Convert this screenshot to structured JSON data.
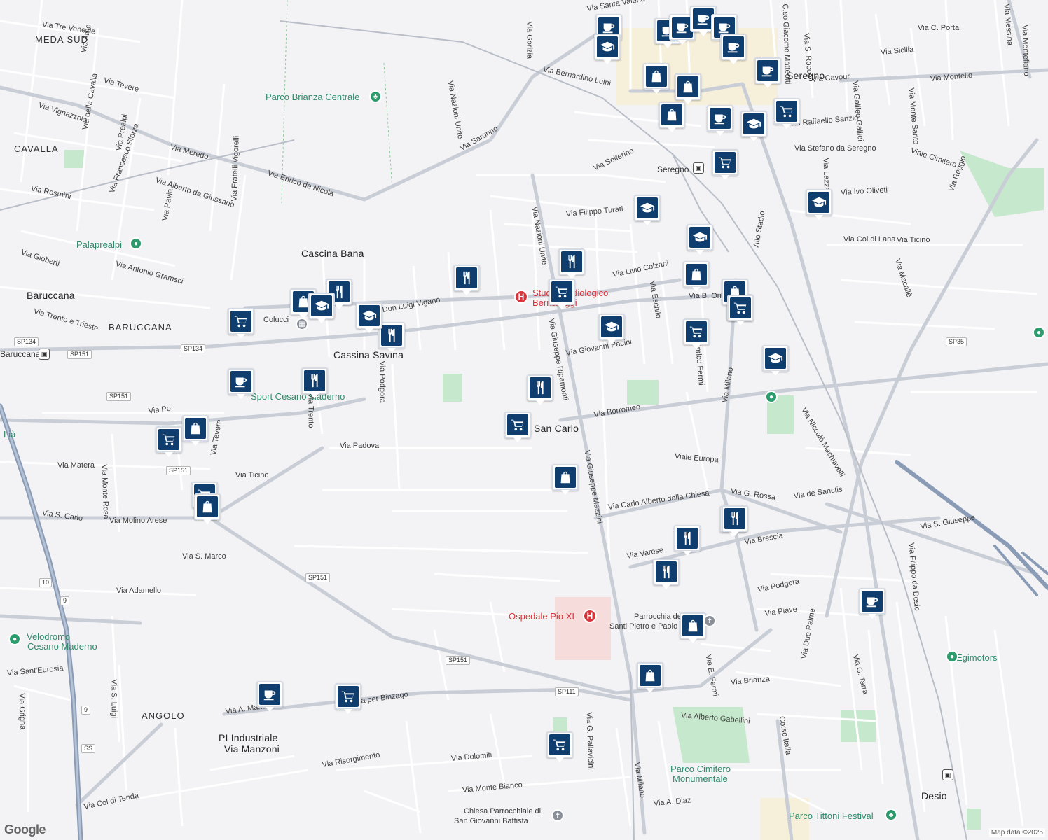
{
  "map": {
    "attribution": "Map data ©2025",
    "logo": "Google",
    "colors": {
      "background": "#f3f3f5",
      "street": "#ffffff",
      "main_road": "#c9cdd6",
      "highway": "#8a9bb5",
      "park": "#c6e8cc",
      "urban_center": "#f8edc8",
      "hospital_area": "#f7dcdc",
      "marker": "#0f3e6e",
      "poi_green": "#2e9b6c",
      "hospital_red": "#d9343b"
    },
    "area_labels": [
      {
        "text": "MEDA SUD",
        "cls": "district"
      },
      {
        "text": "CAVALLA",
        "cls": "district"
      },
      {
        "text": "BARUCCANA",
        "cls": "district"
      },
      {
        "text": "ANGOLO",
        "cls": "district"
      },
      {
        "text": "Cascina Bana",
        "cls": "area"
      },
      {
        "text": "Baruccana",
        "cls": "area"
      },
      {
        "text": "Cassina Savina",
        "cls": "area"
      },
      {
        "text": "San Carlo",
        "cls": "area"
      },
      {
        "text": "Seregno",
        "cls": "area"
      },
      {
        "text": "PI Industriale",
        "cls": "area"
      },
      {
        "text": "Via Manzoni",
        "cls": "area"
      },
      {
        "text": "Desio",
        "cls": "area"
      }
    ],
    "poi_labels": [
      {
        "text": "Parco Brianza Centrale",
        "cls": "poi"
      },
      {
        "text": "Palaprealpi",
        "cls": "poi"
      },
      {
        "text": "Velodromo",
        "cls": "poi"
      },
      {
        "text": "Cesano Maderno",
        "cls": "poi"
      },
      {
        "text": "Egimotors",
        "cls": "poi"
      },
      {
        "text": "Parco Cimitero",
        "cls": "poi"
      },
      {
        "text": "Monumentale",
        "cls": "poi"
      },
      {
        "text": "Parco Tittoni Festival",
        "cls": "poi"
      },
      {
        "text": "Sport Cesano Maderno",
        "cls": "poi"
      },
      {
        "text": "Ospedale Pio XI",
        "cls": "hosp"
      },
      {
        "text": "Studio Radiologico",
        "cls": "hosp"
      },
      {
        "text": "Bernareggi",
        "cls": "hosp"
      },
      {
        "text": "Parrocchia dei",
        "cls": "lbl"
      },
      {
        "text": "Santi Pietro e Paolo",
        "cls": "lbl"
      },
      {
        "text": "Chiesa Parrocchiale di",
        "cls": "lbl"
      },
      {
        "text": "San Giovanni Battista",
        "cls": "lbl"
      },
      {
        "text": "Seregno",
        "cls": "station"
      },
      {
        "text": "Baruccana",
        "cls": "station"
      },
      {
        "text": "Lià",
        "cls": "poi"
      },
      {
        "text": "Colucci",
        "cls": "lbl"
      }
    ],
    "street_labels": [
      "Via Tre Venezie",
      "Via Arno",
      "Via Tevere",
      "Via Vignazzola",
      "Via Meredo",
      "Via Enrico de Nicola",
      "Via Saronno",
      "Via Nazioni Unite",
      "Via Gorizia",
      "Via Bernardino Luini",
      "Via Santa Valeria",
      "Via Rosmini",
      "Via della Cavalla",
      "Via Prealpi",
      "Via Francesco Sforza",
      "Via Alberto da Giussano",
      "Via Fratelli Vigorelli",
      "Via Pavia",
      "Via Gioberti",
      "Via Antonio Gramsci",
      "Via Trento e Trieste",
      "Don Luigi Viganò",
      "Via Livio Colzani",
      "Via Filippo Turati",
      "Via Solferino",
      "Via Nazioni Unite",
      "Via Giuseppe Ripamonti",
      "Via Giovanni Pacini",
      "Via Eschilo",
      "Enrico Fermi",
      "Via Borromeo",
      "Viale Europa",
      "Via Giuseppe Mazzini",
      "Via Carlo Alberto dalla Chiesa",
      "Via G. Rossa",
      "Via de Sanctis",
      "Via Niccolò Machiavelli",
      "Via Milano",
      "Via Po",
      "Via Trento",
      "Via Padova",
      "Via Podgora",
      "Via Matera",
      "Via Monte Rosa",
      "Via Ticino",
      "Via Tevere",
      "Via S. Carlo",
      "Via Molino Arese",
      "Via S. Marco",
      "Via Adamello",
      "Via Sant'Eurosia",
      "Via Grigna",
      "Via S. Luigi",
      "Via A. Manzoni",
      "Via per Binzago",
      "Via Risorgimento",
      "Via Dolomiti",
      "Via Monte Bianco",
      "Via Col di Tenda",
      "Via G. Pallavicini",
      "Via Milano",
      "Via A. Diaz",
      "Via Alberto Gabellini",
      "Via Brianza",
      "Via E. Fermi",
      "Corso Italia",
      "Via Due Palme",
      "Via G. Tarra",
      "Via Varese",
      "Via Brescia",
      "Via Podgora",
      "Via Piave",
      "Via S. Giuseppe",
      "Via Filippo da Desio",
      "Via Cavour",
      "Via Montello",
      "Via Raffaello Sanzio",
      "Via Stefano da Seregno",
      "Viale Cimitero",
      "Via Reggio",
      "Via Ivo Oliveti",
      "Via Col di Lana",
      "Via Ticino",
      "Via Macallè",
      "Via S. Rocco",
      "Via Galileo Galilei",
      "Via Monte Santo",
      "Via Sicilia",
      "Via C. Porta",
      "Via Messina",
      "Via Montefiano",
      "C.so Giacomo Matteotti",
      "Via Lazzaretto",
      "Allo Stadio",
      "Via B. Oriani"
    ],
    "road_shields": [
      "SP134",
      "SP134",
      "SP151",
      "SP151",
      "SP151",
      "SP151",
      "SP151",
      "SP111",
      "SP35",
      "10",
      "9",
      "9",
      "SS"
    ],
    "markers": [
      {
        "type": "cafe",
        "name": "cafe-marker"
      },
      {
        "type": "cafe",
        "name": "cafe-marker"
      },
      {
        "type": "cafe",
        "name": "cafe-marker"
      },
      {
        "type": "cafe",
        "name": "cafe-marker"
      },
      {
        "type": "cafe",
        "name": "cafe-marker"
      },
      {
        "type": "school",
        "name": "school-marker"
      },
      {
        "type": "shop",
        "name": "shop-marker"
      },
      {
        "type": "shop",
        "name": "shop-marker"
      },
      {
        "type": "cafe",
        "name": "cafe-marker"
      },
      {
        "type": "shop",
        "name": "shop-marker"
      },
      {
        "type": "cafe",
        "name": "cafe-marker"
      },
      {
        "type": "cafe",
        "name": "cafe-marker"
      },
      {
        "type": "school",
        "name": "school-marker"
      },
      {
        "type": "grocery",
        "name": "grocery-marker"
      },
      {
        "type": "grocery",
        "name": "grocery-marker"
      },
      {
        "type": "school",
        "name": "school-marker"
      },
      {
        "type": "school",
        "name": "school-marker"
      },
      {
        "type": "school",
        "name": "school-marker"
      },
      {
        "type": "restaurant",
        "name": "restaurant-marker"
      },
      {
        "type": "restaurant",
        "name": "restaurant-marker"
      },
      {
        "type": "grocery",
        "name": "grocery-marker"
      },
      {
        "type": "shop",
        "name": "shop-marker"
      },
      {
        "type": "shop",
        "name": "shop-marker"
      },
      {
        "type": "restaurant",
        "name": "restaurant-marker"
      },
      {
        "type": "grocery",
        "name": "grocery-marker"
      },
      {
        "type": "school",
        "name": "school-marker"
      },
      {
        "type": "grocery",
        "name": "grocery-marker"
      },
      {
        "type": "shop",
        "name": "shop-marker"
      },
      {
        "type": "restaurant",
        "name": "restaurant-marker"
      },
      {
        "type": "school",
        "name": "school-marker"
      },
      {
        "type": "grocery",
        "name": "grocery-marker"
      },
      {
        "type": "restaurant",
        "name": "restaurant-marker"
      },
      {
        "type": "school",
        "name": "school-marker"
      },
      {
        "type": "school",
        "name": "school-marker"
      },
      {
        "type": "restaurant",
        "name": "restaurant-marker"
      },
      {
        "type": "grocery",
        "name": "grocery-marker"
      },
      {
        "type": "cafe",
        "name": "cafe-marker"
      },
      {
        "type": "grocery",
        "name": "grocery-marker"
      },
      {
        "type": "restaurant",
        "name": "restaurant-marker"
      },
      {
        "type": "grocery",
        "name": "grocery-marker"
      },
      {
        "type": "shop",
        "name": "shop-marker"
      },
      {
        "type": "grocery",
        "name": "grocery-marker"
      },
      {
        "type": "shop",
        "name": "shop-marker"
      },
      {
        "type": "shop",
        "name": "shop-marker"
      },
      {
        "type": "restaurant",
        "name": "restaurant-marker"
      },
      {
        "type": "restaurant",
        "name": "restaurant-marker"
      },
      {
        "type": "restaurant",
        "name": "restaurant-marker"
      },
      {
        "type": "cafe",
        "name": "cafe-marker"
      },
      {
        "type": "shop",
        "name": "shop-marker"
      },
      {
        "type": "shop",
        "name": "shop-marker"
      },
      {
        "type": "cafe",
        "name": "cafe-marker"
      },
      {
        "type": "grocery",
        "name": "grocery-marker"
      },
      {
        "type": "grocery",
        "name": "grocery-marker"
      }
    ]
  }
}
